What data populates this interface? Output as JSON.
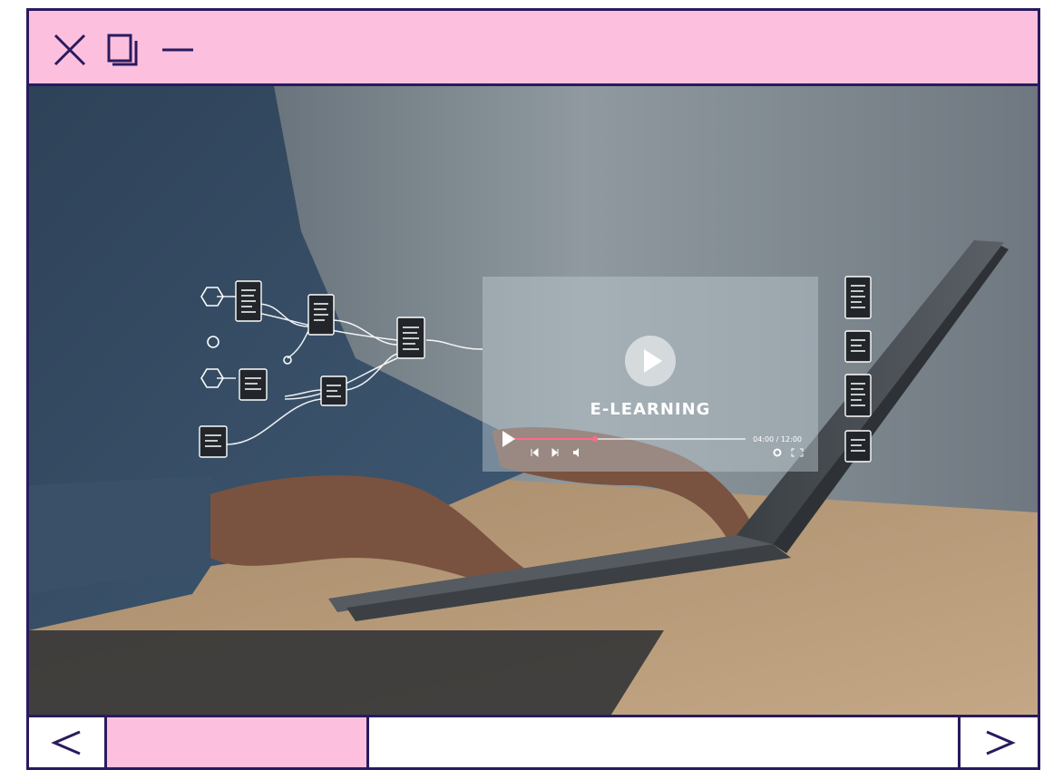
{
  "window": {
    "close_icon": "close-icon",
    "restore_icon": "restore-icon",
    "minimize_icon": "minimize-icon"
  },
  "video_card": {
    "title": "E-LEARNING",
    "time": "04:00 / 12:00"
  },
  "navigation": {
    "prev_icon": "chevron-left-icon",
    "next_icon": "chevron-right-icon",
    "progress": 0.29
  },
  "colors": {
    "accent_pink": "#fcc0de",
    "border_navy": "#2a1a5e"
  }
}
